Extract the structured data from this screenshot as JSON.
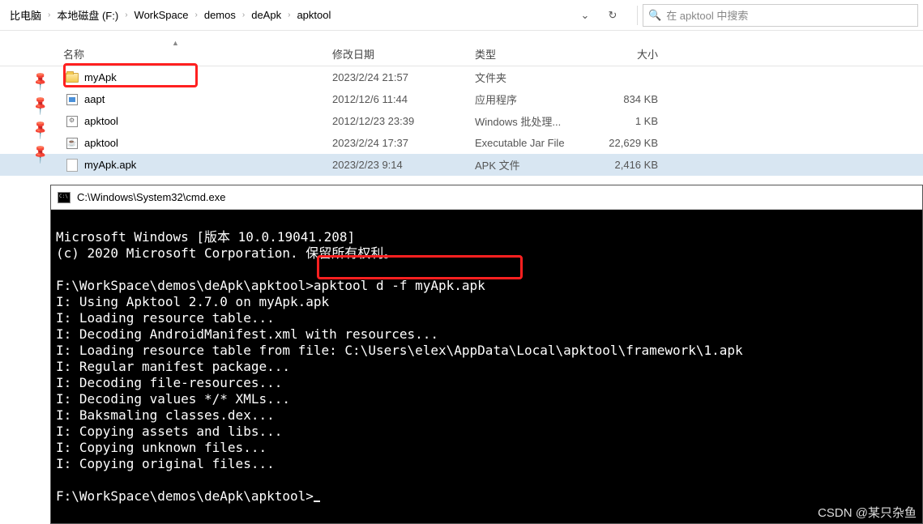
{
  "breadcrumb": {
    "items": [
      "比电脑",
      "本地磁盘 (F:)",
      "WorkSpace",
      "demos",
      "deApk",
      "apktool"
    ]
  },
  "search": {
    "placeholder": "在 apktool 中搜索"
  },
  "columns": {
    "name": "名称",
    "date": "修改日期",
    "type": "类型",
    "size": "大小"
  },
  "files": [
    {
      "icon": "folder",
      "name": "myApk",
      "date": "2023/2/24 21:57",
      "type": "文件夹",
      "size": "",
      "selected": false
    },
    {
      "icon": "exe",
      "name": "aapt",
      "date": "2012/12/6 11:44",
      "type": "应用程序",
      "size": "834 KB",
      "selected": false
    },
    {
      "icon": "bat",
      "name": "apktool",
      "date": "2012/12/23 23:39",
      "type": "Windows 批处理...",
      "size": "1 KB",
      "selected": false
    },
    {
      "icon": "jar",
      "name": "apktool",
      "date": "2023/2/24 17:37",
      "type": "Executable Jar File",
      "size": "22,629 KB",
      "selected": false
    },
    {
      "icon": "blank",
      "name": "myApk.apk",
      "date": "2023/2/23 9:14",
      "type": "APK 文件",
      "size": "2,416 KB",
      "selected": true
    }
  ],
  "cmd": {
    "title": "C:\\Windows\\System32\\cmd.exe",
    "lines": [
      "Microsoft Windows [版本 10.0.19041.208]",
      "(c) 2020 Microsoft Corporation. 保留所有权利。",
      "",
      "F:\\WorkSpace\\demos\\deApk\\apktool>apktool d -f myApk.apk",
      "I: Using Apktool 2.7.0 on myApk.apk",
      "I: Loading resource table...",
      "I: Decoding AndroidManifest.xml with resources...",
      "I: Loading resource table from file: C:\\Users\\elex\\AppData\\Local\\apktool\\framework\\1.apk",
      "I: Regular manifest package...",
      "I: Decoding file-resources...",
      "I: Decoding values */* XMLs...",
      "I: Baksmaling classes.dex...",
      "I: Copying assets and libs...",
      "I: Copying unknown files...",
      "I: Copying original files...",
      "",
      "F:\\WorkSpace\\demos\\deApk\\apktool>"
    ]
  },
  "watermark": "CSDN @某只杂鱼"
}
